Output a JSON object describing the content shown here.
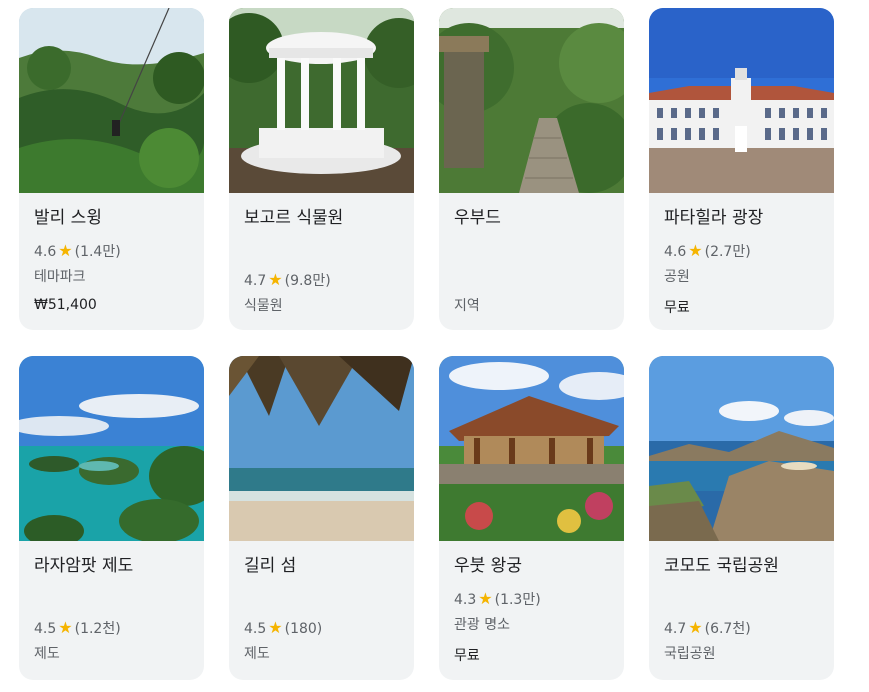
{
  "places": [
    {
      "title": "발리 스윙",
      "rating": "4.6",
      "reviews": "(1.4만)",
      "category": "테마파크",
      "price": "₩51,400",
      "image": "jungle-swing"
    },
    {
      "title": "보고르 식물원",
      "rating": "4.7",
      "reviews": "(9.8만)",
      "category": "식물원",
      "price": "",
      "image": "white-gazebo"
    },
    {
      "title": "우부드",
      "rating": "",
      "reviews": "",
      "category": "지역",
      "price": "",
      "image": "jungle-stairs"
    },
    {
      "title": "파타힐라 광장",
      "rating": "4.6",
      "reviews": "(2.7만)",
      "category": "공원",
      "price": "무료",
      "image": "colonial-building"
    },
    {
      "title": "라자암팟 제도",
      "rating": "4.5",
      "reviews": "(1.2천)",
      "category": "제도",
      "price": "",
      "image": "tropical-islands"
    },
    {
      "title": "길리 섬",
      "rating": "4.5",
      "reviews": "(180)",
      "category": "제도",
      "price": "",
      "image": "beach"
    },
    {
      "title": "우붓 왕궁",
      "rating": "4.3",
      "reviews": "(1.3만)",
      "category": "관광 명소",
      "price": "무료",
      "image": "balinese-palace"
    },
    {
      "title": "코모도 국립공원",
      "rating": "4.7",
      "reviews": "(6.7천)",
      "category": "국립공원",
      "price": "",
      "image": "komodo-hills"
    }
  ],
  "star_icon": "star-icon",
  "colors": {
    "star": "#f5b400",
    "card": "#f1f3f4",
    "secondary_text": "#5f6368"
  }
}
